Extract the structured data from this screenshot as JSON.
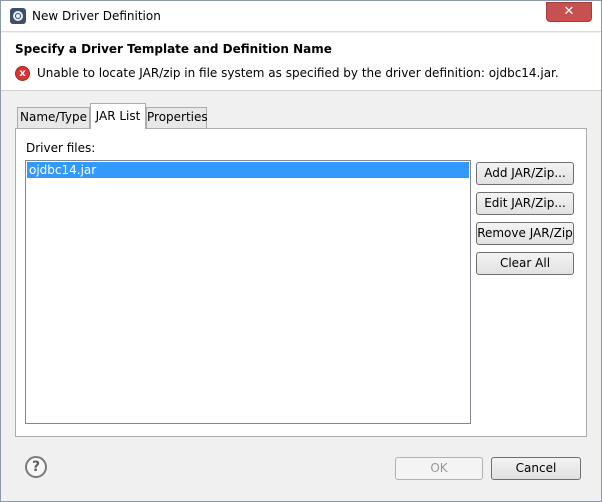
{
  "window": {
    "title": "New Driver Definition",
    "close_label": "✕"
  },
  "header": {
    "title": "Specify a Driver Template and Definition Name",
    "error_icon_glyph": "x",
    "error_message": "Unable to locate JAR/zip in file system as specified by the driver definition: ojdbc14.jar."
  },
  "tabs": [
    {
      "label": "Name/Type",
      "active": false
    },
    {
      "label": "JAR List",
      "active": true
    },
    {
      "label": "Properties",
      "active": false
    }
  ],
  "jar_list": {
    "label": "Driver files:",
    "files": [
      "ojdbc14.jar"
    ],
    "selected_index": 0
  },
  "buttons": {
    "add": "Add JAR/Zip...",
    "edit": "Edit JAR/Zip...",
    "remove": "Remove JAR/Zip",
    "clear": "Clear All"
  },
  "footer": {
    "help_glyph": "?",
    "ok": "OK",
    "ok_enabled": false,
    "cancel": "Cancel"
  },
  "colors": {
    "selection": "#3399ff",
    "error": "#d83434",
    "close_button": "#c75050"
  },
  "icons": {
    "app": "eclipse-icon",
    "error": "error-icon",
    "help": "help-icon",
    "close": "close-icon"
  }
}
